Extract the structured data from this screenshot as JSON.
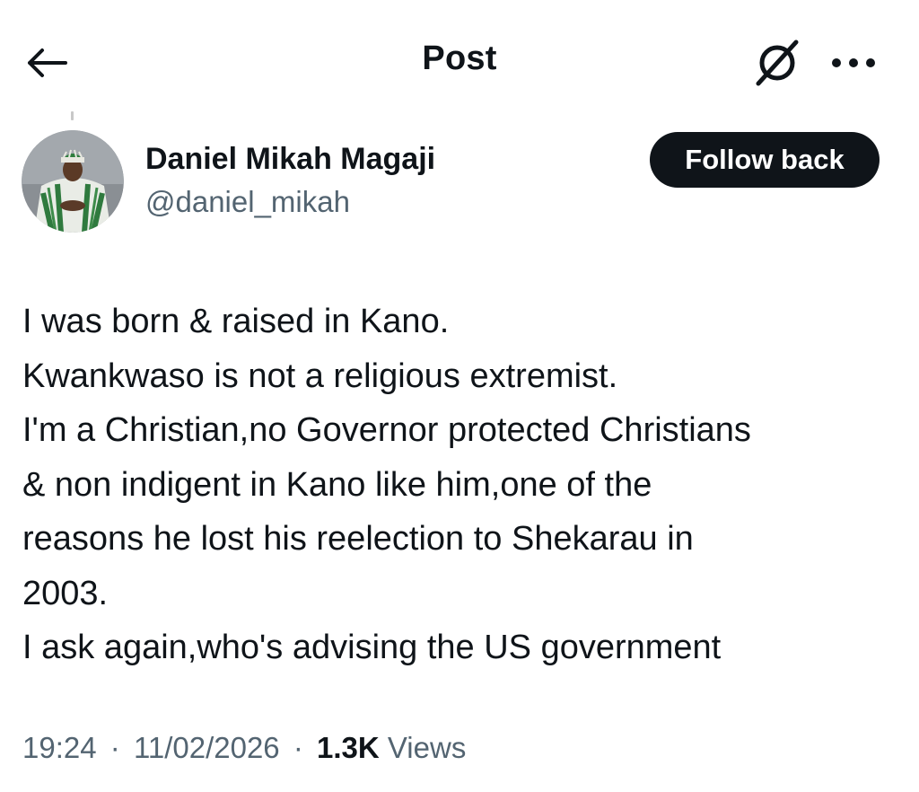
{
  "header": {
    "title": "Post",
    "back_icon": "arrow-left-icon",
    "grok_icon": "grok-slash-icon",
    "more_icon": "more-horizontal-icon"
  },
  "author": {
    "name": "Daniel Mikah Magaji",
    "handle": "@daniel_mikah",
    "follow_label": "Follow back",
    "avatar_icon": "avatar-photo"
  },
  "post": {
    "lines": [
      "I was born & raised in Kano.",
      "Kwankwaso is not a religious extremist.",
      "I'm a Christian,no Governor protected Christians",
      "& non indigent in Kano like him,one of the",
      "reasons he lost his reelection to Shekarau in",
      "2003.",
      "I ask again,who's advising the US government"
    ]
  },
  "meta": {
    "time": "19:24",
    "date": "11/02/2026",
    "separator": "·",
    "views_count": "1.3K",
    "views_label": "Views"
  },
  "colors": {
    "text_primary": "#0f1419",
    "text_secondary": "#536471",
    "button_bg": "#0f1419",
    "button_text": "#ffffff"
  }
}
